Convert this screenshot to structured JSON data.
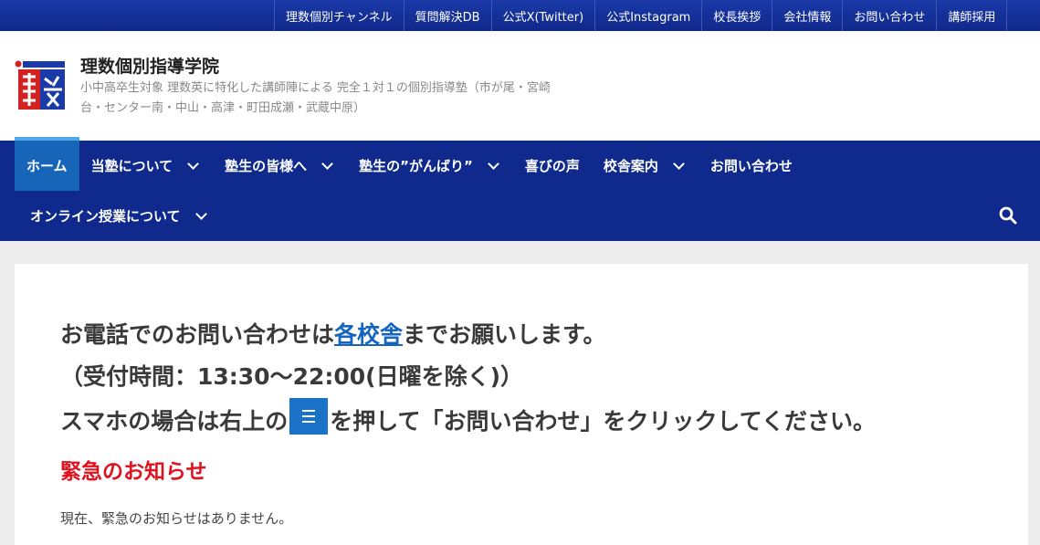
{
  "topbar": {
    "links": [
      "理数個別チャンネル",
      "質問解決DB",
      "公式X(Twitter)",
      "公式Instagram",
      "校長挨拶",
      "会社情報",
      "お問い合わせ",
      "講師採用"
    ]
  },
  "header": {
    "title": "理数個別指導学院",
    "description": "小中高卒生対象 理数英に特化した講師陣による 完全１対１の個別指導塾（市が尾・宮崎台・センター南・中山・高津・町田成瀬・武蔵中原）"
  },
  "nav": {
    "items": [
      {
        "label": "ホーム",
        "active": true,
        "dropdown": false
      },
      {
        "label": "当塾について",
        "active": false,
        "dropdown": true
      },
      {
        "label": "塾生の皆様へ",
        "active": false,
        "dropdown": true
      },
      {
        "label": "塾生の”がんばり”",
        "active": false,
        "dropdown": true
      },
      {
        "label": "喜びの声",
        "active": false,
        "dropdown": false
      },
      {
        "label": "校舎案内",
        "active": false,
        "dropdown": true
      },
      {
        "label": "お問い合わせ",
        "active": false,
        "dropdown": false
      }
    ],
    "row2": [
      {
        "label": "オンライン授業について",
        "dropdown": true
      }
    ],
    "search_icon": "search-icon"
  },
  "content": {
    "line1_before": "お電話でのお問い合わせは",
    "line1_link": "各校舎",
    "line1_after": "までお願いします。",
    "line2": "（受付時間：13:30〜22:00(日曜を除く)）",
    "line3_before": "スマホの場合は右上の",
    "line3_after": "を押して「お問い合わせ」をクリックしてください。",
    "urgent_title": "緊急のお知らせ",
    "urgent_text": "現在、緊急のお知らせはありません。"
  },
  "colors": {
    "nav_bg": "#0f2a8c",
    "active_bg": "#1765b8",
    "link": "#1565c0",
    "urgent": "#e0121f"
  }
}
